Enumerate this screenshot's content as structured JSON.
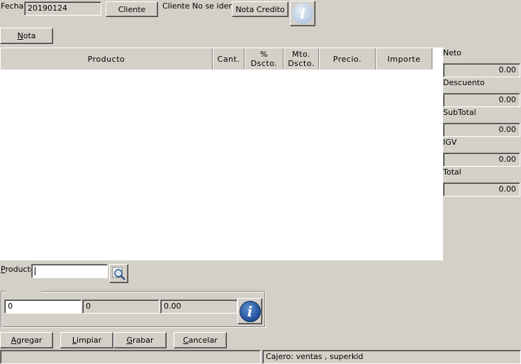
{
  "header": {
    "fecha_label": "Fecha",
    "fecha_value": "20190124",
    "cliente_button": "Cliente",
    "cliente_status": "Cliente No se ident",
    "nota_credito_button": "Nota Credito",
    "nota_button_mnemonic": "N",
    "nota_button_rest": "ota"
  },
  "table": {
    "columns": [
      {
        "line1": "Producto",
        "line2": ""
      },
      {
        "line1": "Cant.",
        "line2": ""
      },
      {
        "line1": "%",
        "line2": "Dscto."
      },
      {
        "line1": "Mto.",
        "line2": "Dscto."
      },
      {
        "line1": "Precio.",
        "line2": ""
      },
      {
        "line1": "Importe",
        "line2": ""
      }
    ],
    "rows": []
  },
  "totals": {
    "neto_label": "Neto",
    "neto_value": "0.00",
    "descuento_label": "Descuento",
    "descuento_value": "0.00",
    "subtotal_label": "SubTotal",
    "subtotal_value": "0.00",
    "igv_label": "IGV",
    "igv_value": "0.00",
    "total_label": "Total",
    "total_value": "0.00"
  },
  "producto": {
    "label_mnemonic": "P",
    "label_rest": "roducto",
    "input_value": ""
  },
  "item": {
    "cantidad_value": "0",
    "field2_value": "0",
    "field3_value": "0.00"
  },
  "actions": {
    "agregar_mnemonic": "A",
    "agregar_rest": "gregar",
    "limpiar_mnemonic": "L",
    "limpiar_rest": "impiar",
    "grabar_mnemonic": "G",
    "grabar_rest": "rabar",
    "cancelar_mnemonic": "C",
    "cancelar_rest": "ancelar"
  },
  "status": {
    "left_text": "",
    "cajero_text": "Cajero: ventas , superkid"
  },
  "icons": {
    "info_top": "info-icon",
    "search": "search-icon",
    "info_bottom": "info-icon"
  }
}
